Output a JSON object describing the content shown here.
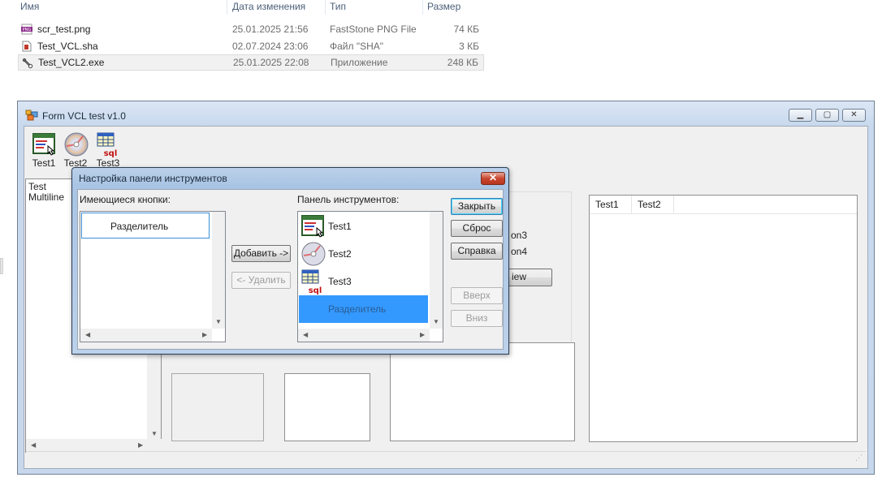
{
  "explorer": {
    "columns": {
      "name": "Имя",
      "date": "Дата изменения",
      "type": "Тип",
      "size": "Размер"
    },
    "files": [
      {
        "name": "scr_test.png",
        "date": "25.01.2025 21:56",
        "type": "FastStone PNG File",
        "size": "74 КБ",
        "icon": "png-file-icon"
      },
      {
        "name": "Test_VCL.sha",
        "date": "02.07.2024 23:06",
        "type": "Файл \"SHA\"",
        "size": "3 КБ",
        "icon": "sha-file-icon"
      },
      {
        "name": "Test_VCL2.exe",
        "date": "25.01.2025 22:08",
        "type": "Приложение",
        "size": "248 КБ",
        "icon": "exe-file-icon"
      }
    ]
  },
  "window": {
    "title": "Form VCL test v1.0",
    "icon": "app-icon",
    "toolbar": [
      {
        "label": "Test1",
        "icon": "form-editor-icon"
      },
      {
        "label": "Test2",
        "icon": "cd-disc-icon"
      },
      {
        "label": "Test3",
        "icon": "sql-table-icon"
      }
    ],
    "memo_text": [
      "Test",
      "Multiline"
    ],
    "behind_text": {
      "button_part": "iew",
      "radio1": "on3",
      "radio2": "on4"
    },
    "listview_columns": [
      "Test1",
      "Test2"
    ]
  },
  "dialog": {
    "title": "Настройка панели инструментов",
    "available_label": "Имеющиеся кнопки:",
    "available_items": [
      "Разделитель"
    ],
    "toolbar_label": "Панель инструментов:",
    "toolbar_items": [
      {
        "label": "Test1",
        "icon": "form-editor-icon"
      },
      {
        "label": "Test2",
        "icon": "cd-disc-icon"
      },
      {
        "label": "Test3",
        "icon": "sql-table-icon"
      },
      {
        "label": "Разделитель",
        "icon": ""
      }
    ],
    "buttons": {
      "add": "Добавить ->",
      "remove": "<- Удалить",
      "close": "Закрыть",
      "reset": "Сброс",
      "help": "Справка",
      "up": "Вверх",
      "down": "Вниз"
    }
  }
}
